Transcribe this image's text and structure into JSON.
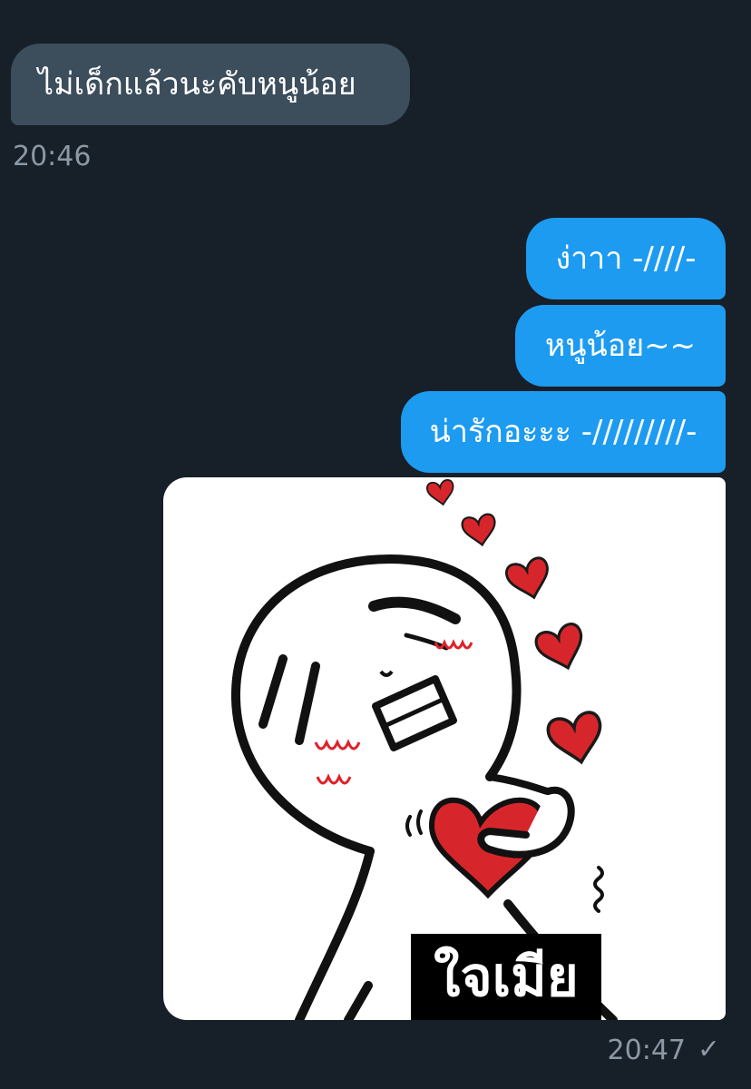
{
  "messages": {
    "incoming": {
      "text": "ไม่เด็กแล้วนะคับหนูน้อย",
      "time": "20:46"
    },
    "outgoing": [
      {
        "text": "ง่าาา -////-"
      },
      {
        "text": "หนูน้อย~~"
      },
      {
        "text": "น่ารักอะะะ -/////////-"
      }
    ],
    "sticker": {
      "caption": "ใจเมีย",
      "time": "20:47",
      "status_icon": "checkmark-icon",
      "status_glyph": "✓"
    }
  },
  "colors": {
    "background": "#171f28",
    "incoming_bubble": "#3c4d5c",
    "outgoing_bubble": "#1d9bf0",
    "timestamp": "#8b98a5",
    "heart": "#d7262b"
  }
}
